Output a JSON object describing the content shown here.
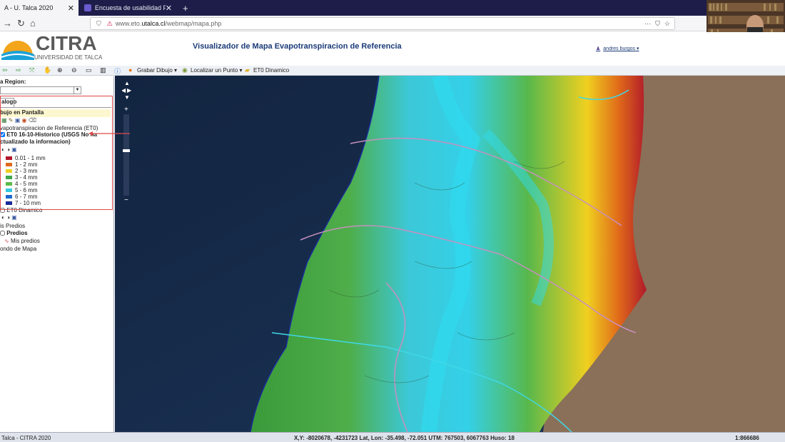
{
  "browser": {
    "tabs": [
      {
        "title": "A - U. Talca 2020",
        "active": true
      },
      {
        "title": "Encuesta de usabilidad Platafo",
        "active": false
      }
    ],
    "new_tab": "+",
    "url_prefix": "www.eto.",
    "url_domain": "utalca.cl",
    "url_path": "/webmap/mapa.php"
  },
  "header": {
    "logo_name": "CITRA",
    "logo_subtitle": "UNIVERSIDAD DE TALCA",
    "app_title": "Visualizador de Mapa Evapotranspiracion de Referencia",
    "user_name": "andres burgos"
  },
  "toolbar": {
    "grabar": "Grabar Dibujo",
    "localizar": "Localizar un Punto",
    "et0": "ET0 Dinamico"
  },
  "left_panel": {
    "region_label": "a Region:",
    "catalog_tab": "alogo",
    "dibujo_label": "bujo en Pantalla",
    "layer_group": "vapotranspiracion de Referencia (ET0)",
    "layer_name_1": "ET0 16-10-Historico (USGS No ha",
    "layer_name_2": "ctualizado la informacion)",
    "legend": [
      {
        "label": "0.01 - 1 mm",
        "color": "#b0182a"
      },
      {
        "label": "1 - 2 mm",
        "color": "#e06a1a"
      },
      {
        "label": "2 - 3 mm",
        "color": "#f0d020"
      },
      {
        "label": "3 - 4 mm",
        "color": "#3ea84a"
      },
      {
        "label": "4 - 5 mm",
        "color": "#5cba4c"
      },
      {
        "label": "5 - 6 mm",
        "color": "#36c8e0"
      },
      {
        "label": "6 - 7 mm",
        "color": "#1e6ad0"
      },
      {
        "label": "7 - 10 mm",
        "color": "#1a2a9a"
      }
    ],
    "et0_dinamico": "ET0 Dinamico",
    "mis_predios_1": "is Predios",
    "predios": "Predios",
    "mis_predios_2": "Mis predios",
    "fondo": "ondo de Mapa"
  },
  "status": {
    "left": "Talca - CITRA 2020",
    "coords": "X,Y: -8020678, -4231723 Lat, Lon: -35.498, -72.051 UTM: 767503, 6067763 Huso: 18",
    "scale": "1:866686"
  }
}
